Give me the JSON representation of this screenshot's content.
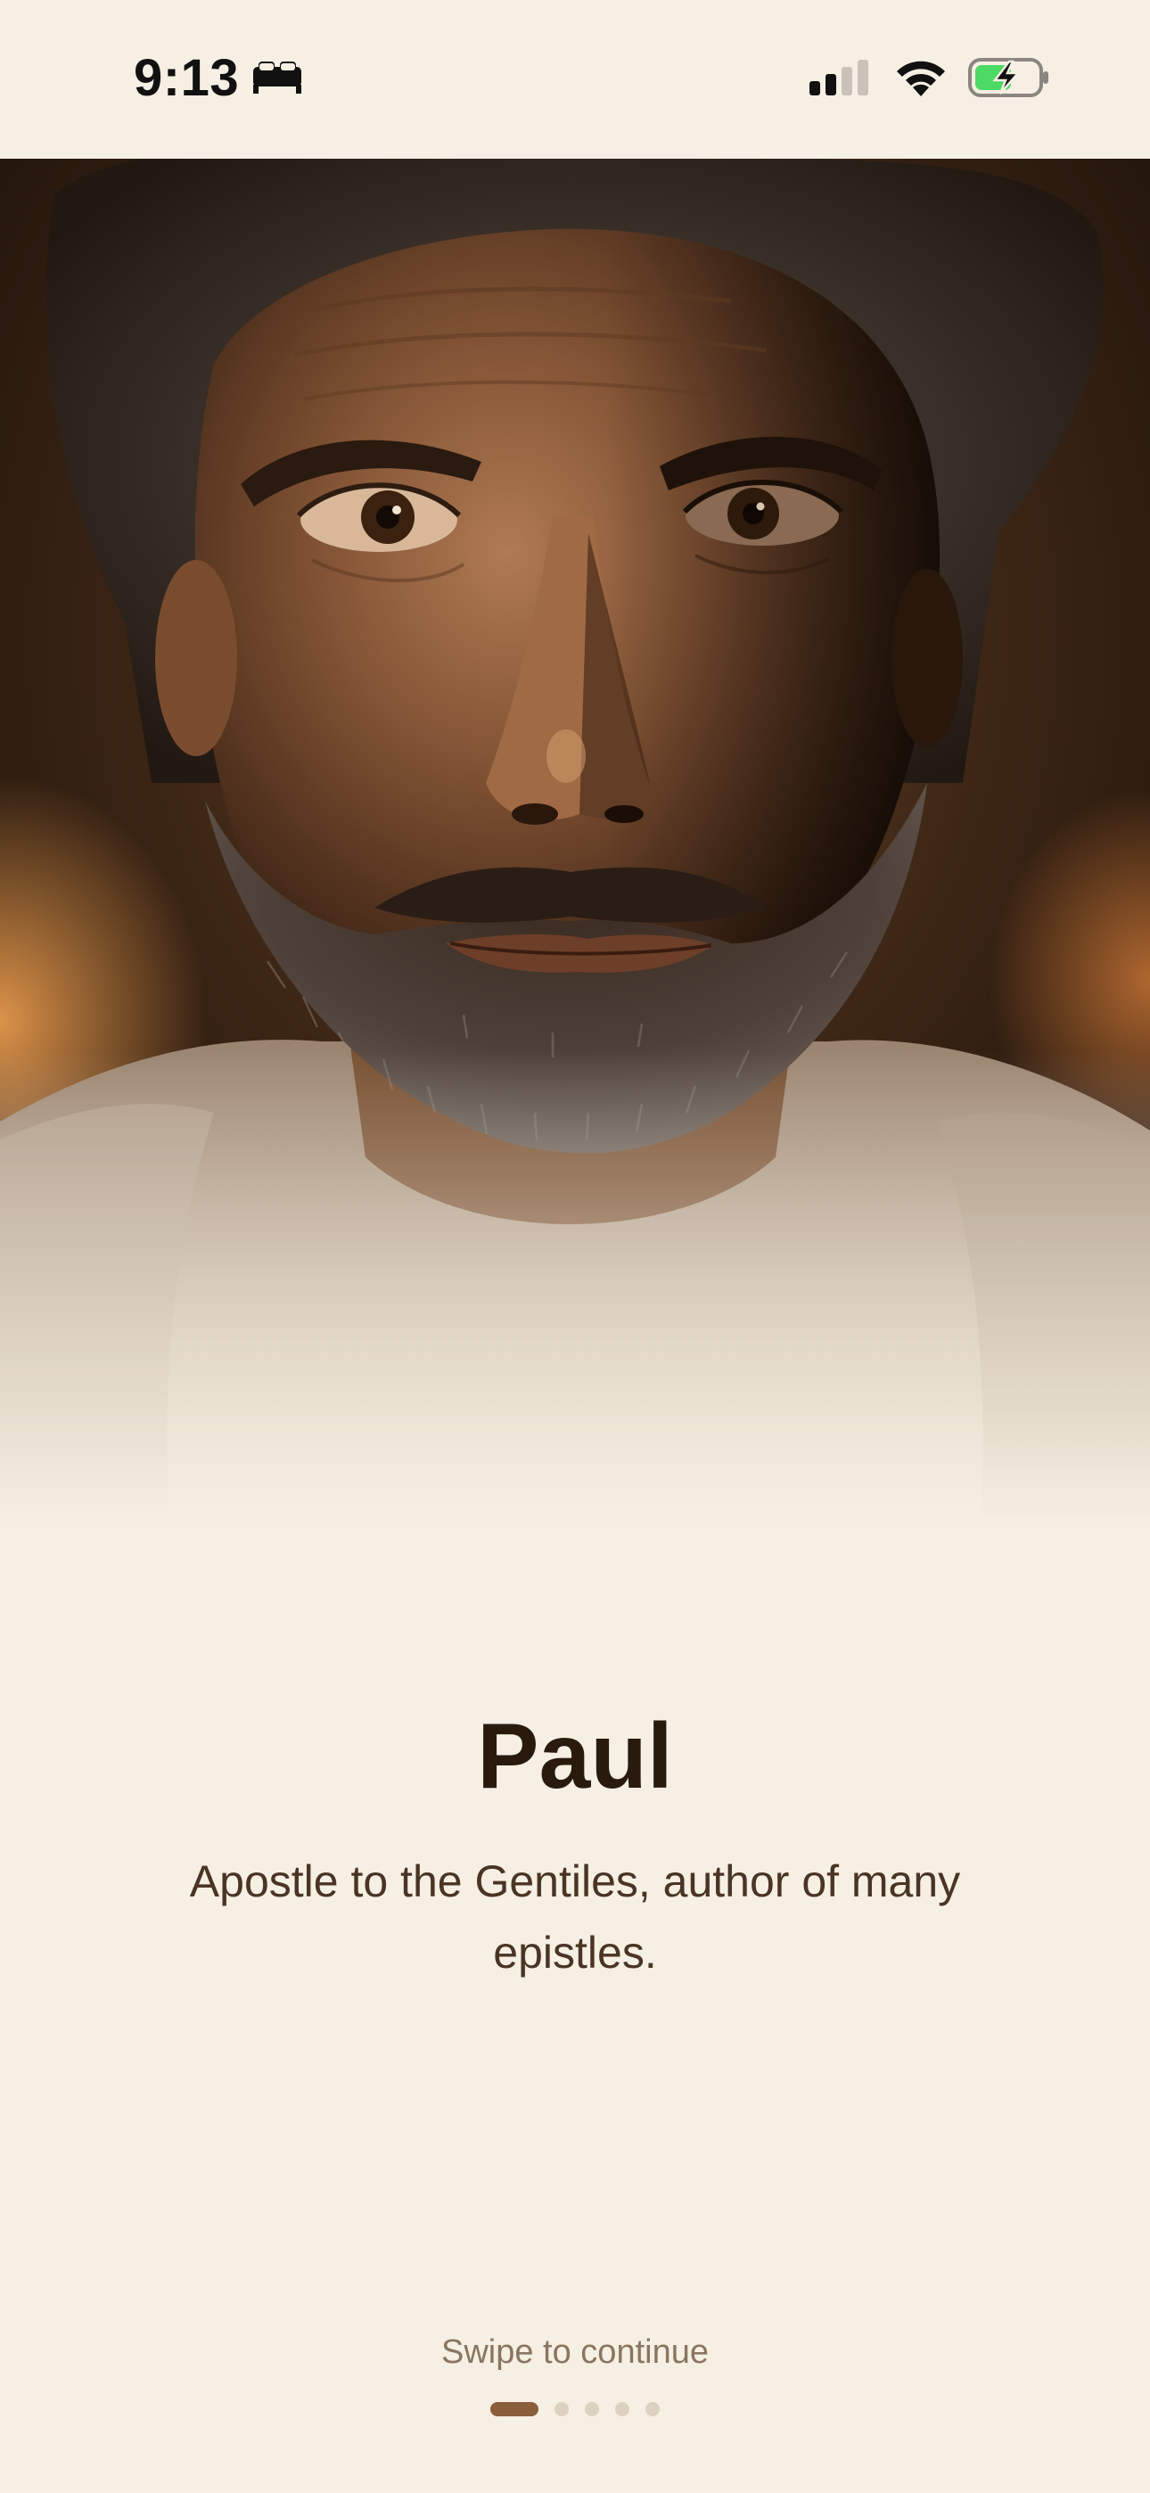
{
  "status_bar": {
    "time": "9:13",
    "focus_mode_icon": "bed-icon",
    "cellular_icon": "cellular-signal-icon",
    "wifi_icon": "wifi-icon",
    "battery_icon": "battery-charging-icon",
    "battery_color": "#4cd964"
  },
  "hero": {
    "image": "portrait-of-paul",
    "tone_color": "#3a2414"
  },
  "content": {
    "name": "Paul",
    "description": "Apostle to the Gentiles, author of many epistles."
  },
  "footer": {
    "swipe_hint": "Swipe to continue",
    "page_count": 5,
    "current_page": 1,
    "active_dot_color": "#8b5e3c"
  },
  "colors": {
    "background": "#f6efe3",
    "title": "#2a1a0e",
    "body": "#4a3424",
    "hint": "#8a7560"
  }
}
